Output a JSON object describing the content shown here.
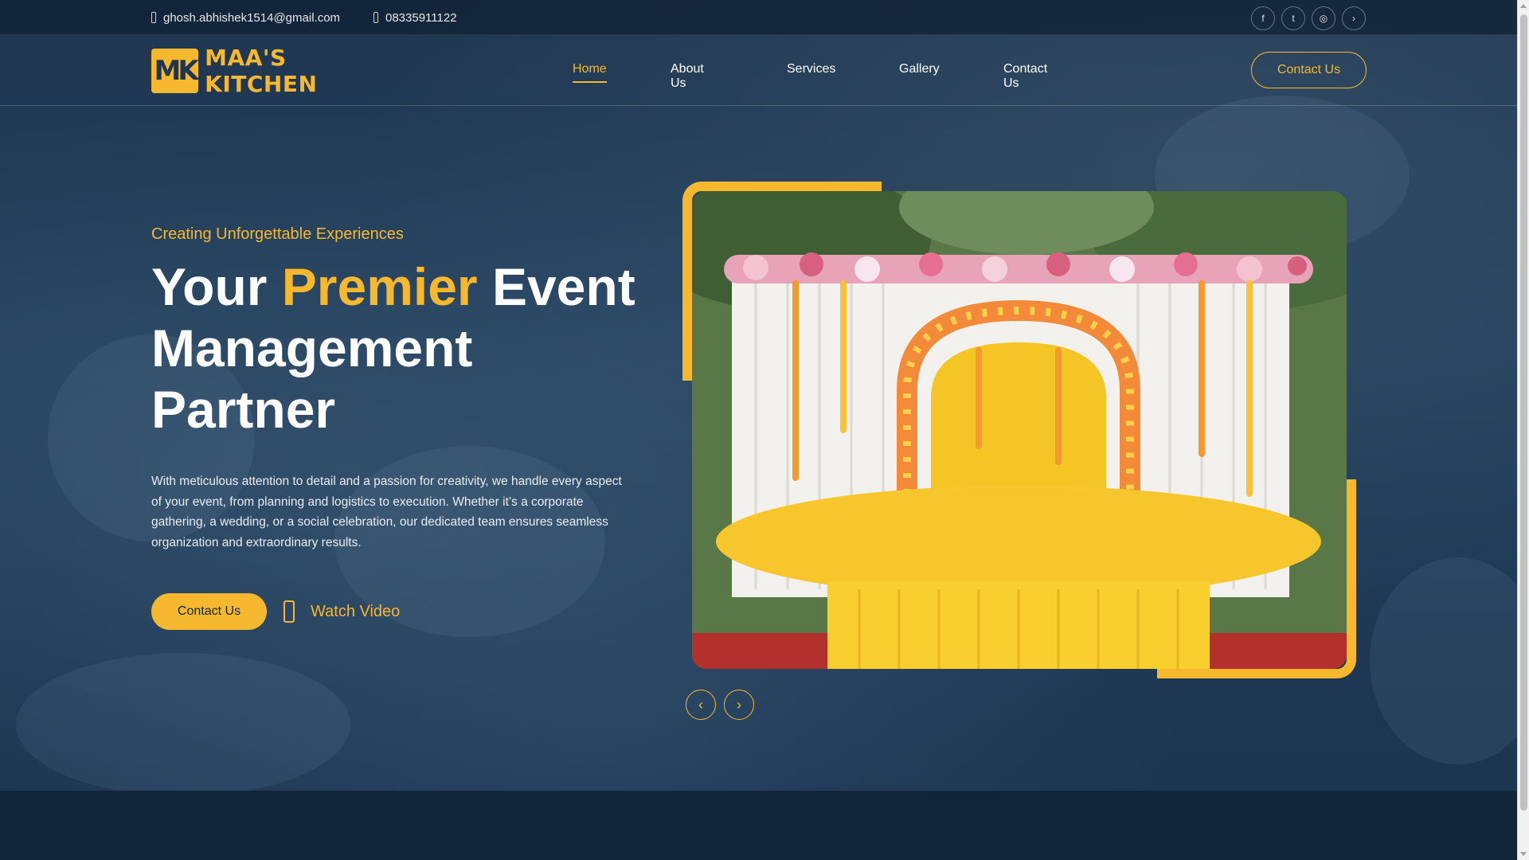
{
  "topbar": {
    "email": "ghosh.abhishek1514@gmail.com",
    "phone": "08335911122",
    "socials": [
      {
        "icon": "facebook-icon",
        "glyph": "f"
      },
      {
        "icon": "twitter-icon",
        "glyph": "t"
      },
      {
        "icon": "instagram-icon",
        "glyph": "◎"
      },
      {
        "icon": "youtube-icon",
        "glyph": "›"
      }
    ]
  },
  "brand": {
    "logo_letters": "MK",
    "name": "MAA'S KITCHEN"
  },
  "nav": {
    "items": [
      {
        "label": "Home",
        "active": true
      },
      {
        "label": "About Us",
        "active": false
      },
      {
        "label": "Services",
        "active": false
      },
      {
        "label": "Gallery",
        "active": false
      },
      {
        "label": "Contact Us",
        "active": false
      }
    ],
    "cta_label": "Contact Us"
  },
  "hero": {
    "eyebrow": "Creating Unforgettable Experiences",
    "headline_pre": "Your ",
    "headline_accent": "Premier",
    "headline_post": " Event Management Partner",
    "description": "With meticulous attention to detail and a passion for creativity, we handle every aspect of your event, from planning and logistics to execution. Whether it’s a corporate gathering, a wedding, or a social celebration, our dedicated team ensures seamless organization and extraordinary results.",
    "primary_button": "Contact Us",
    "video_button": "Watch Video"
  },
  "slider": {
    "prev_glyph": "‹",
    "next_glyph": "›"
  },
  "colors": {
    "accent": "#f6b82e",
    "navy": "#13253b"
  }
}
